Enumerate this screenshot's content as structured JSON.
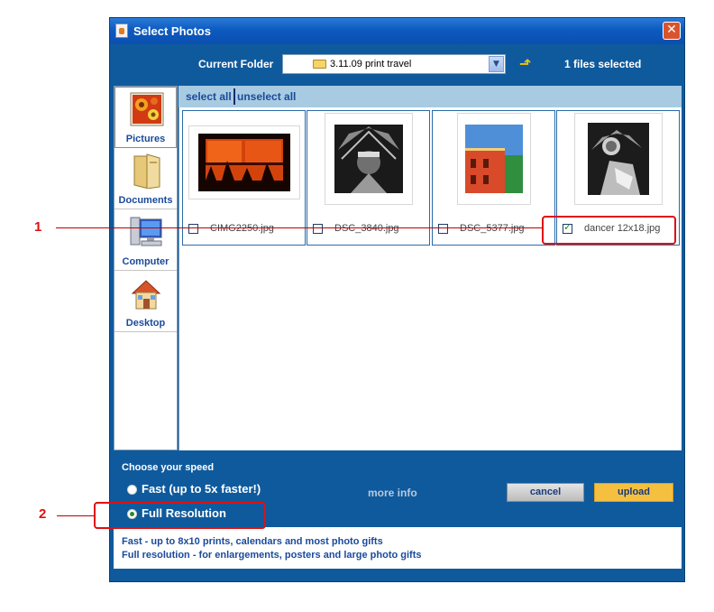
{
  "window": {
    "title": "Select Photos",
    "close_symbol": "✕"
  },
  "toolbar": {
    "folder_label": "Current Folder",
    "folder_value": "3.11.09 print travel",
    "files_selected": "1 files selected",
    "up_icon": "folder-up-icon"
  },
  "sidebar": {
    "items": [
      {
        "label": "Pictures",
        "icon": "pictures-icon"
      },
      {
        "label": "Documents",
        "icon": "documents-icon"
      },
      {
        "label": "Computer",
        "icon": "computer-icon"
      },
      {
        "label": "Desktop",
        "icon": "desktop-icon"
      }
    ]
  },
  "selection": {
    "select_all": "select all",
    "unselect_all": "unselect all"
  },
  "photos": [
    {
      "name": "CIMG2250.jpg",
      "checked": false
    },
    {
      "name": "DSC_3840.jpg",
      "checked": false
    },
    {
      "name": "DSC_5377.jpg",
      "checked": false
    },
    {
      "name": "dancer 12x18.jpg",
      "checked": true
    }
  ],
  "speed": {
    "title": "Choose your speed",
    "options": [
      {
        "label": "Fast (up to 5x faster!)",
        "selected": false
      },
      {
        "label": "Full Resolution",
        "selected": true
      }
    ],
    "more_info": "more info"
  },
  "buttons": {
    "cancel": "cancel",
    "upload": "upload"
  },
  "notes": [
    "Fast - up to 8x10 prints, calendars and most photo gifts",
    "Full resolution - for enlargements, posters and large photo gifts"
  ],
  "annotations": {
    "callout_1": "1",
    "callout_2": "2"
  },
  "colors": {
    "window_blue": "#0f5a9d",
    "select_bar": "#a8cbe2",
    "upload_yellow": "#f5c040",
    "callout_red": "#e01010"
  }
}
